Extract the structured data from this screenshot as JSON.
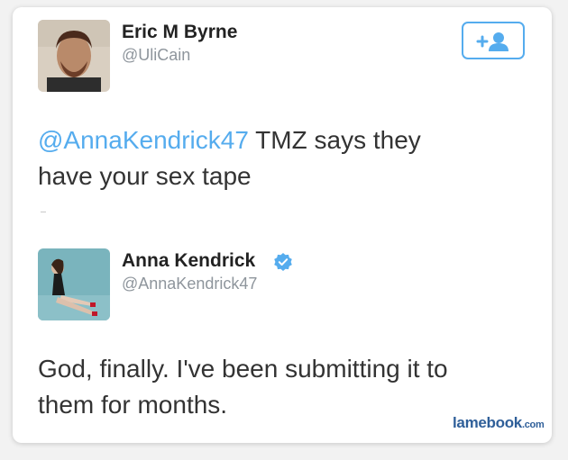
{
  "tweet1": {
    "name": "Eric M Byrne",
    "handle": "@UliCain",
    "mention": "@AnnaKendrick47",
    "text_line1": " TMZ says they",
    "text_line2": "have your sex tape",
    "follow_icon": "add-user-icon",
    "accent_color": "#55acee"
  },
  "tweet2": {
    "name": "Anna Kendrick",
    "handle": "@AnnaKendrick47",
    "verified_icon": "verified-badge-icon",
    "text_line1": "God, finally. I've been submitting it to",
    "text_line2": "them for months."
  },
  "watermark": {
    "main": "lamebook",
    "suffix": ".com"
  }
}
